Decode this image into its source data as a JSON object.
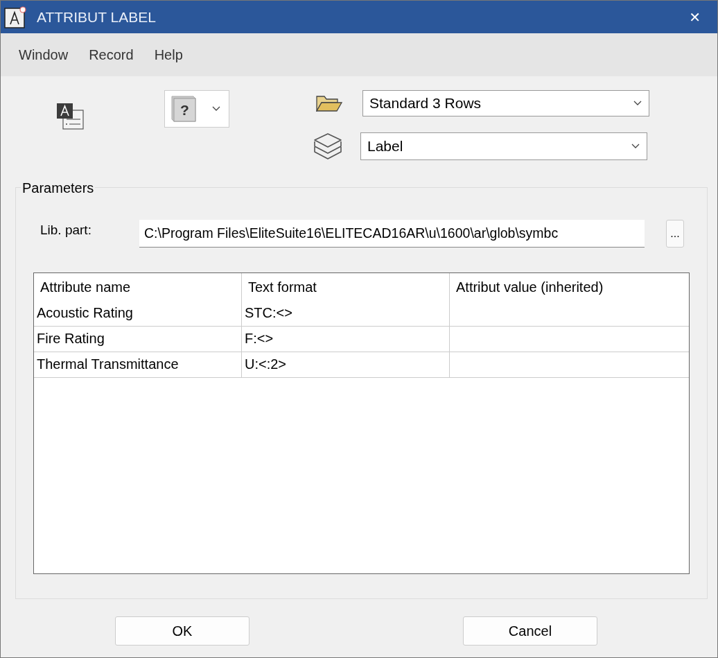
{
  "window": {
    "title": "ATTRIBUT LABEL",
    "close": "✕"
  },
  "menu": [
    "Window",
    "Record",
    "Help"
  ],
  "toolbar": {
    "symbol_button": {
      "glyph": "?"
    },
    "template_combo": {
      "value": "Standard 3 Rows"
    },
    "layer_combo": {
      "value": "Label"
    }
  },
  "parameters": {
    "title": "Parameters",
    "lib_part": {
      "label": "Lib. part:",
      "value": "C:\\Program Files\\EliteSuite16\\ELITECAD16AR\\u\\1600\\ar\\glob\\symbc",
      "browse": "..."
    },
    "table": {
      "columns": [
        "Attribute name",
        "Text format",
        "Attribut value (inherited)"
      ],
      "rows": [
        [
          "Acoustic Rating",
          "STC:<>",
          ""
        ],
        [
          "Fire Rating",
          "F:<>",
          ""
        ],
        [
          "Thermal Transmittance",
          "U:<:2>",
          ""
        ]
      ]
    }
  },
  "buttons": [
    "OK",
    "Cancel"
  ]
}
